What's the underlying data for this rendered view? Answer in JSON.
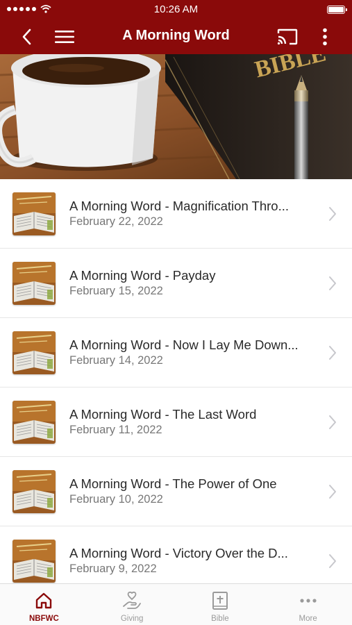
{
  "status_bar": {
    "time": "10:26 AM"
  },
  "header": {
    "title": "A Morning Word"
  },
  "hero": {
    "bible_text": "BIBLE"
  },
  "items": [
    {
      "title": "A Morning Word - Magnification Thro...",
      "date": "February 22, 2022"
    },
    {
      "title": "A Morning Word - Payday",
      "date": "February 15, 2022"
    },
    {
      "title": "A Morning Word - Now I Lay Me Down...",
      "date": "February 14, 2022"
    },
    {
      "title": "A Morning Word - The Last Word",
      "date": "February 11, 2022"
    },
    {
      "title": "A Morning Word - The Power of One",
      "date": "February 10, 2022"
    },
    {
      "title": "A Morning Word - Victory Over the D...",
      "date": "February 9, 2022"
    }
  ],
  "tabs": [
    {
      "label": "NBFWC",
      "icon": "home-icon",
      "active": true
    },
    {
      "label": "Giving",
      "icon": "giving-hand-icon",
      "active": false
    },
    {
      "label": "Bible",
      "icon": "bible-icon",
      "active": false
    },
    {
      "label": "More",
      "icon": "more-horizontal-icon",
      "active": false
    }
  ],
  "colors": {
    "brand": "#8a0a0a",
    "inactive": "#9a9a9a"
  }
}
